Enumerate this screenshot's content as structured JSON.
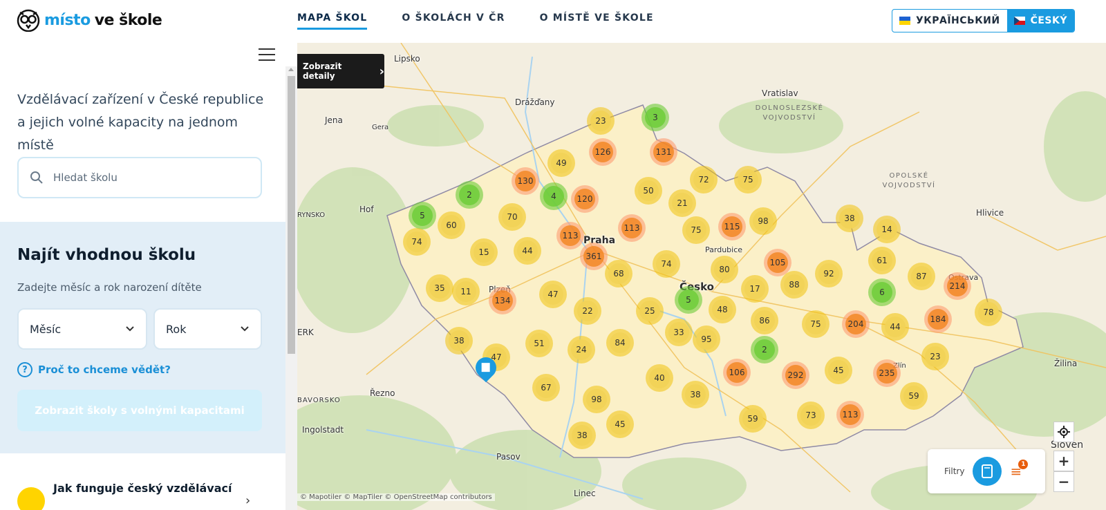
{
  "header": {
    "logo_part1": "místo",
    "logo_part2": "ve škole",
    "nav": [
      {
        "label": "MAPA ŠKOL",
        "active": true
      },
      {
        "label": "O ŠKOLÁCH V ČR",
        "active": false
      },
      {
        "label": "O MÍSTĚ VE ŠKOLE",
        "active": false
      }
    ],
    "lang_ua": "УКРАЇНСЬКИЙ",
    "lang_cz": "ČESKÝ"
  },
  "sidebar": {
    "intro": "Vzdělávací zařízení v České republice a jejich volné kapacity na jednom místě",
    "search_placeholder": "Hledat školu",
    "finder_title": "Najít vhodnou školu",
    "finder_sub": "Zadejte měsíc a rok narození dítěte",
    "month_label": "Měsíc",
    "year_label": "Rok",
    "why_link": "Proč to chceme vědět?",
    "show_button": "Zobrazit školy s volnými kapacitami",
    "how_item": "Jak funguje český vzdělávací"
  },
  "map": {
    "detail_button": "Zobrazit detaily",
    "filters_label": "Filtry",
    "filter_badge": "1",
    "zoom_in": "+",
    "zoom_out": "−",
    "attribution": "© Mapotiler © MapTiler © OpenStreetMap contributors",
    "places": [
      {
        "name": "Lipsko",
        "big": false
      },
      {
        "name": "Drážďany",
        "big": false
      },
      {
        "name": "Jena",
        "big": false
      },
      {
        "name": "Gera",
        "big": false
      },
      {
        "name": "Hof",
        "big": false
      },
      {
        "name": "Vratislav",
        "big": false
      },
      {
        "name": "Praha",
        "big": true
      },
      {
        "name": "Plzeň",
        "big": false
      },
      {
        "name": "Pardubice",
        "big": false
      },
      {
        "name": "Česko",
        "big": true
      },
      {
        "name": "Hlivice",
        "big": false
      },
      {
        "name": "Ostrava",
        "big": false
      },
      {
        "name": "Žilina",
        "big": false
      },
      {
        "name": "Řezno",
        "big": false
      },
      {
        "name": "Ingolstadt",
        "big": false
      },
      {
        "name": "Pasov",
        "big": false
      },
      {
        "name": "Linec",
        "big": false
      },
      {
        "name": "Zlín",
        "big": false
      },
      {
        "name": "ERK",
        "big": false
      },
      {
        "name": "RYNSKO",
        "big": false
      },
      {
        "name": "BAVORSKO",
        "big": false
      },
      {
        "name": "Sloven",
        "big": false
      }
    ],
    "regions": [
      "DOLNOSLEZSKÉ VOJVODSTVÍ",
      "OPOLSKÉ VOJVODSTVÍ"
    ],
    "clusters": [
      {
        "v": "23",
        "c": "y"
      },
      {
        "v": "3",
        "c": "g"
      },
      {
        "v": "126",
        "c": "o"
      },
      {
        "v": "131",
        "c": "o"
      },
      {
        "v": "49",
        "c": "y"
      },
      {
        "v": "130",
        "c": "o"
      },
      {
        "v": "2",
        "c": "g"
      },
      {
        "v": "4",
        "c": "g"
      },
      {
        "v": "120",
        "c": "o"
      },
      {
        "v": "50",
        "c": "y"
      },
      {
        "v": "72",
        "c": "y"
      },
      {
        "v": "75",
        "c": "y"
      },
      {
        "v": "21",
        "c": "y"
      },
      {
        "v": "5",
        "c": "g"
      },
      {
        "v": "60",
        "c": "y"
      },
      {
        "v": "70",
        "c": "y"
      },
      {
        "v": "113",
        "c": "o"
      },
      {
        "v": "113",
        "c": "o"
      },
      {
        "v": "75",
        "c": "y"
      },
      {
        "v": "115",
        "c": "o"
      },
      {
        "v": "98",
        "c": "y"
      },
      {
        "v": "38",
        "c": "y"
      },
      {
        "v": "14",
        "c": "y"
      },
      {
        "v": "74",
        "c": "y"
      },
      {
        "v": "15",
        "c": "y"
      },
      {
        "v": "44",
        "c": "y"
      },
      {
        "v": "361",
        "c": "o"
      },
      {
        "v": "74",
        "c": "y"
      },
      {
        "v": "80",
        "c": "y"
      },
      {
        "v": "105",
        "c": "o"
      },
      {
        "v": "61",
        "c": "y"
      },
      {
        "v": "68",
        "c": "y"
      },
      {
        "v": "92",
        "c": "y"
      },
      {
        "v": "87",
        "c": "y"
      },
      {
        "v": "214",
        "c": "o"
      },
      {
        "v": "35",
        "c": "y"
      },
      {
        "v": "11",
        "c": "y"
      },
      {
        "v": "47",
        "c": "y"
      },
      {
        "v": "17",
        "c": "y"
      },
      {
        "v": "88",
        "c": "y"
      },
      {
        "v": "6",
        "c": "g"
      },
      {
        "v": "134",
        "c": "o"
      },
      {
        "v": "22",
        "c": "y"
      },
      {
        "v": "25",
        "c": "y"
      },
      {
        "v": "5",
        "c": "g"
      },
      {
        "v": "48",
        "c": "y"
      },
      {
        "v": "86",
        "c": "y"
      },
      {
        "v": "75",
        "c": "y"
      },
      {
        "v": "204",
        "c": "o"
      },
      {
        "v": "44",
        "c": "y"
      },
      {
        "v": "184",
        "c": "o"
      },
      {
        "v": "78",
        "c": "y"
      },
      {
        "v": "38",
        "c": "y"
      },
      {
        "v": "47",
        "c": "y"
      },
      {
        "v": "51",
        "c": "y"
      },
      {
        "v": "24",
        "c": "y"
      },
      {
        "v": "84",
        "c": "y"
      },
      {
        "v": "33",
        "c": "y"
      },
      {
        "v": "95",
        "c": "y"
      },
      {
        "v": "2",
        "c": "g"
      },
      {
        "v": "23",
        "c": "y"
      },
      {
        "v": "40",
        "c": "y"
      },
      {
        "v": "106",
        "c": "o"
      },
      {
        "v": "292",
        "c": "o"
      },
      {
        "v": "45",
        "c": "y"
      },
      {
        "v": "235",
        "c": "o"
      },
      {
        "v": "67",
        "c": "y"
      },
      {
        "v": "98",
        "c": "y"
      },
      {
        "v": "38",
        "c": "y"
      },
      {
        "v": "59",
        "c": "y"
      },
      {
        "v": "59",
        "c": "y"
      },
      {
        "v": "73",
        "c": "y"
      },
      {
        "v": "113",
        "c": "o"
      },
      {
        "v": "45",
        "c": "y"
      },
      {
        "v": "38",
        "c": "y"
      }
    ]
  }
}
